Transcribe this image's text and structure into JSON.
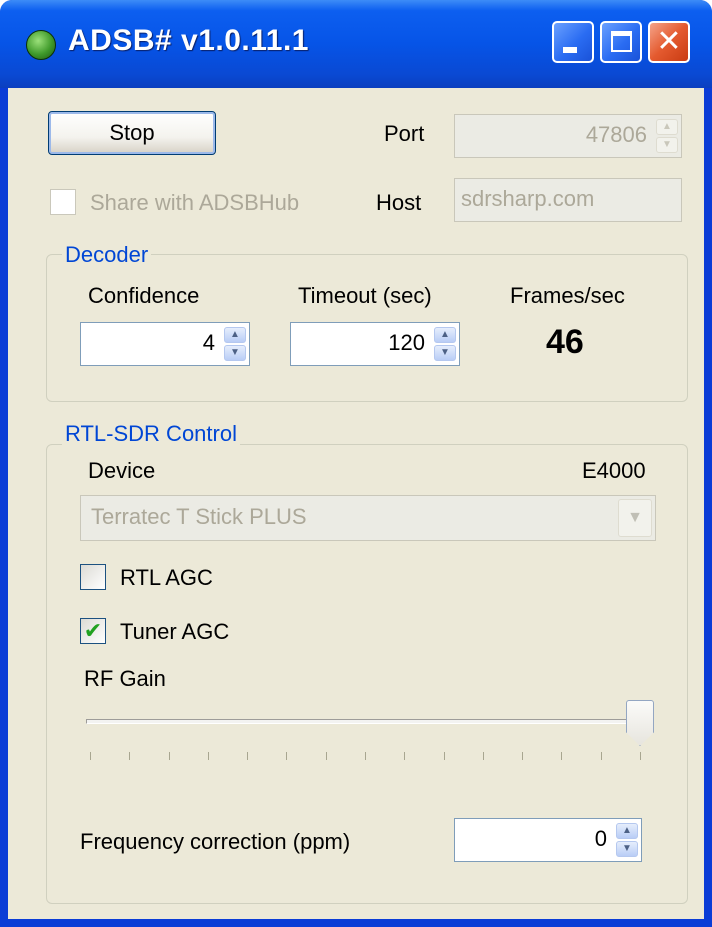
{
  "window": {
    "title": "ADSB# v1.0.11.1"
  },
  "icons": {
    "app": "radar-globe-icon",
    "minimize": "minimize-icon",
    "maximize": "maximize-icon",
    "close": "close-icon"
  },
  "top": {
    "stop_label": "Stop",
    "port_label": "Port",
    "port_value": "47806",
    "share_label": "Share with ADSBHub",
    "share_checked": false,
    "host_label": "Host",
    "host_value": "sdrsharp.com"
  },
  "decoder": {
    "title": "Decoder",
    "confidence_label": "Confidence",
    "confidence_value": "4",
    "timeout_label": "Timeout (sec)",
    "timeout_value": "120",
    "frames_label": "Frames/sec",
    "frames_value": "46"
  },
  "rtl": {
    "title": "RTL-SDR Control",
    "device_label": "Device",
    "tuner_type": "E4000",
    "device_selected": "Terratec T Stick PLUS",
    "rtl_agc_label": "RTL AGC",
    "rtl_agc_checked": false,
    "tuner_agc_label": "Tuner AGC",
    "tuner_agc_checked": true,
    "check_mark": "✔",
    "rf_gain_label": "RF Gain",
    "rf_gain_fraction": 1.0,
    "freq_corr_label": "Frequency correction (ppm)",
    "freq_corr_value": "0"
  },
  "colors": {
    "title_bar": "#0654e7",
    "group_title": "#0046d5",
    "window_bg": "#ece9d8",
    "check": "#21a121",
    "close_button": "#e45a2f"
  }
}
